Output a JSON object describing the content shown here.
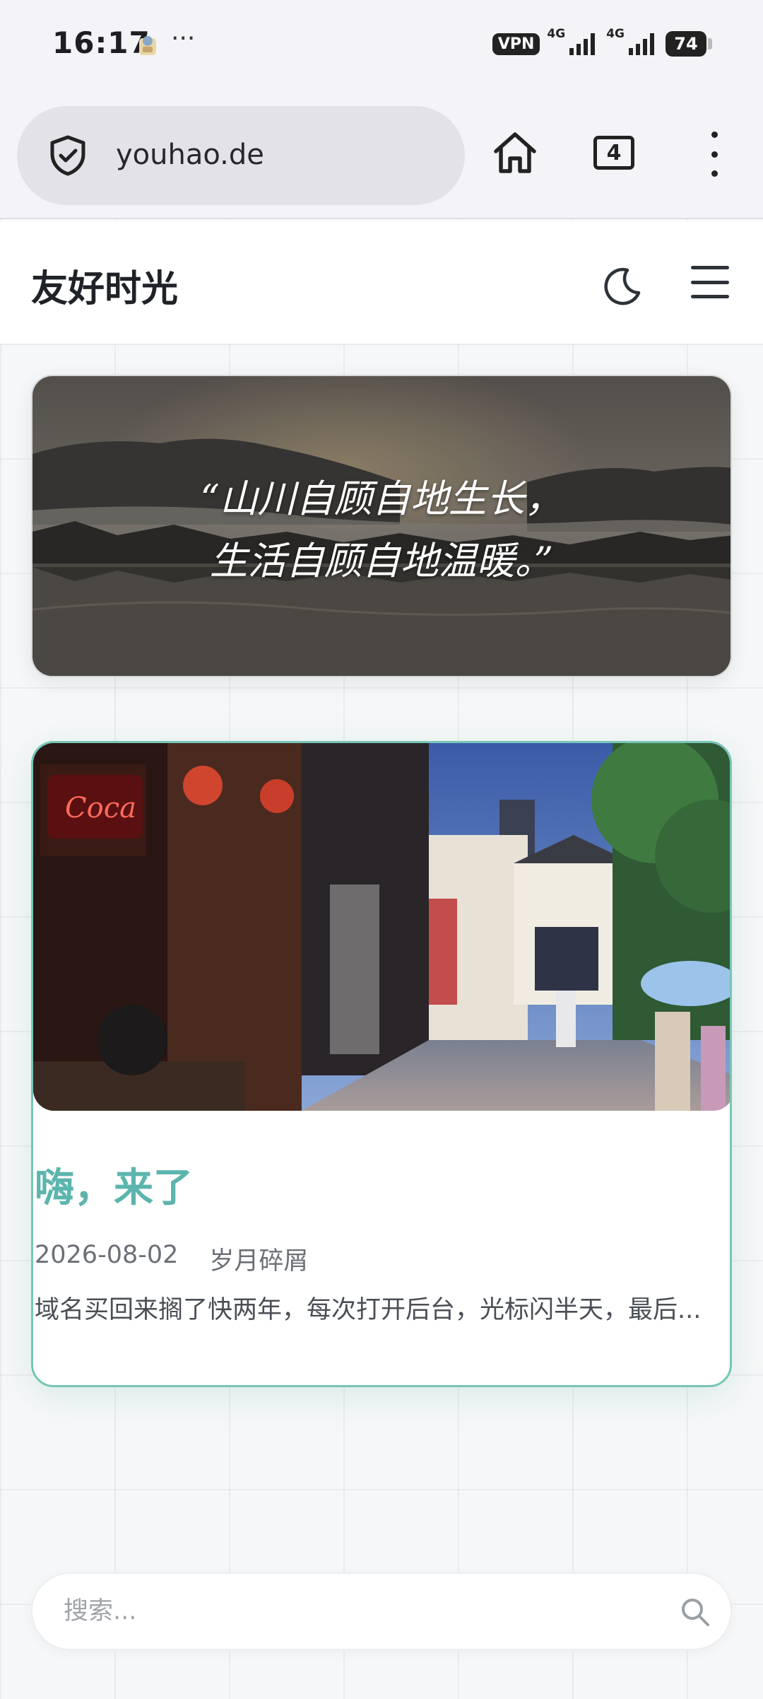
{
  "status_bar": {
    "time": "16:17",
    "overflow": "···",
    "vpn": "VPN",
    "network_1": "4G",
    "network_2": "4G",
    "battery": "74"
  },
  "browser": {
    "url": "youhao.de",
    "tab_count": "4",
    "icons": [
      "shield-icon",
      "home-icon",
      "tabs-icon",
      "more-vert-icon"
    ]
  },
  "site": {
    "title": "友好时光",
    "icons": [
      "moon-icon",
      "hamburger-menu-icon"
    ]
  },
  "banner": {
    "quote_line1": "“山川自顾自地生长，",
    "quote_line2": "生活自顾自地温暖。”"
  },
  "post": {
    "title": "嗨，来了",
    "date": "2026-08-02",
    "category": "岁月碎屑",
    "excerpt": "域名买回来搁了快两年，每次打开后台，光标闪半天，最后..."
  },
  "search": {
    "placeholder": "搜索..."
  },
  "colors": {
    "accent": "#5cb5ad",
    "card_border": "#76c6b6",
    "text_dark": "#1f2328"
  }
}
